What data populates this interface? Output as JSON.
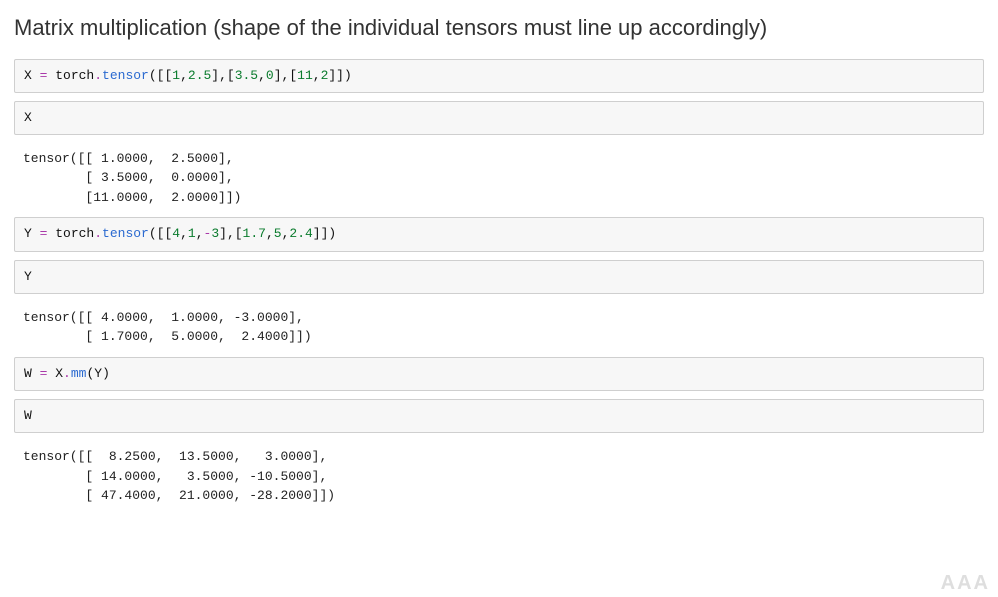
{
  "heading": "Matrix multiplication (shape of the individual tensors must line up accordingly)",
  "cells": {
    "c0": {
      "x": "X",
      "eq": " = ",
      "mod": "torch",
      "dot": ".",
      "fn": "tensor",
      "open": "([[",
      "n0": "1",
      "s0": ",",
      "n1": "2.5",
      "mid0": "],[",
      "n2": "3.5",
      "s1": ",",
      "n3": "0",
      "mid1": "],[",
      "n4": "11",
      "s2": ",",
      "n5": "2",
      "close": "]])"
    },
    "c1": {
      "code": "X"
    },
    "o1": "tensor([[ 1.0000,  2.5000],\n        [ 3.5000,  0.0000],\n        [11.0000,  2.0000]])",
    "c2": {
      "y": "Y",
      "eq": " = ",
      "mod": "torch",
      "dot": ".",
      "fn": "tensor",
      "open": "([[",
      "n0": "4",
      "s0": ",",
      "n1": "1",
      "s1": ",",
      "neg": "-",
      "n2": "3",
      "mid0": "],[",
      "n3": "1.7",
      "s2": ",",
      "n4": "5",
      "s3": ",",
      "n5": "2.4",
      "close": "]])"
    },
    "c3": {
      "code": "Y"
    },
    "o3": "tensor([[ 4.0000,  1.0000, -3.0000],\n        [ 1.7000,  5.0000,  2.4000]])",
    "c4": {
      "w": "W",
      "eq": " = ",
      "x": "X",
      "dot": ".",
      "fn": "mm",
      "open": "(",
      "y": "Y",
      "close": ")"
    },
    "c5": {
      "code": "W"
    },
    "o5": "tensor([[  8.2500,  13.5000,   3.0000],\n        [ 14.0000,   3.5000, -10.5000],\n        [ 47.4000,  21.0000, -28.2000]])"
  },
  "watermark": "AAA"
}
